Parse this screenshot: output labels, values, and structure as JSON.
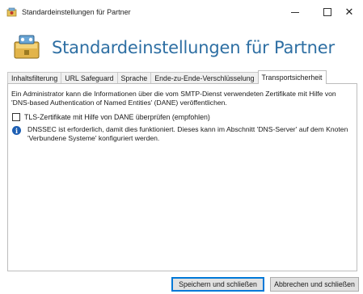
{
  "window": {
    "title": "Standardeinstellungen für Partner",
    "minimize_icon": "minimize-icon",
    "maximize_icon": "maximize-icon",
    "close_icon": "close-icon",
    "close_glyph": "✕"
  },
  "header": {
    "heading": "Standardeinstellungen für Partner",
    "icon": "partner-settings-icon",
    "heading_color": "#2e6fa3"
  },
  "tabs": [
    {
      "label": "Inhaltsfilterung",
      "active": false
    },
    {
      "label": "URL Safeguard",
      "active": false
    },
    {
      "label": "Sprache",
      "active": false
    },
    {
      "label": "Ende-zu-Ende-Verschlüsselung",
      "active": false
    },
    {
      "label": "Transportsicherheit",
      "active": true
    }
  ],
  "panel": {
    "description": "Ein Administrator kann die Informationen über die vom SMTP-Dienst verwendeten Zertifikate mit Hilfe von 'DNS-based Authentication of Named Entities' (DANE) veröffentlichen.",
    "checkbox": {
      "label": "TLS-Zertifikate mit Hilfe von DANE überprüfen (empfohlen)",
      "checked": false
    },
    "info": {
      "icon": "info-icon",
      "glyph": "i",
      "text": "DNSSEC ist erforderlich, damit dies funktioniert. Dieses kann im Abschnitt 'DNS-Server' auf dem Knoten 'Verbundene Systeme' konfiguriert werden."
    }
  },
  "footer": {
    "save_label": "Speichern und schließen",
    "cancel_label": "Abbrechen und schließen"
  }
}
